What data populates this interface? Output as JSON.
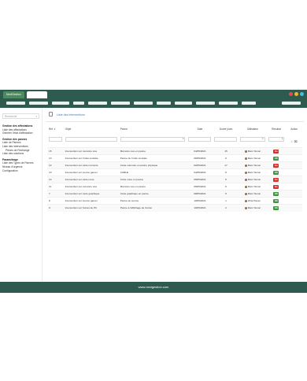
{
  "app": {
    "tab_label": "NextGestion"
  },
  "colors": {
    "bar": "#2f5a4f",
    "ko": "#d9302c",
    "ok": "#3b9b3b",
    "link": "#3a7bc0"
  },
  "window_dots": [
    "#e64c4c",
    "#f0b429",
    "#3bbfe6"
  ],
  "sidebar": {
    "select_placeholder": "Recherche",
    "items": [
      {
        "label": "Gestion des affectations",
        "head": true
      },
      {
        "label": "Liste des affectations",
        "head": false
      },
      {
        "label": "Générer l'état d'affectation",
        "head": false
      },
      {
        "label": "Gestion des pannes",
        "head": true
      },
      {
        "label": "Liste de Pannes",
        "head": false
      },
      {
        "label": "Liste des interventions",
        "head": false
      },
      {
        "label": "Pièces de Rechange",
        "head": false,
        "indent": true
      },
      {
        "label": "Liste des solutions",
        "head": false
      },
      {
        "label": "Paramétrage",
        "head": true
      },
      {
        "label": "Liste des Types de Pannes",
        "head": false
      },
      {
        "label": "Niveau d'urgence",
        "head": false
      },
      {
        "label": "Configuration",
        "head": false
      }
    ]
  },
  "main": {
    "title": "Liste des interventions"
  },
  "table": {
    "headers": [
      "Ref. ▾",
      "Objet",
      "Panne",
      "Date",
      "Durée jours",
      "Utilisateur",
      "Résultat",
      "Action"
    ],
    "rows": [
      [
        "15",
        "Intervention sur mémoire vive",
        "Mémoire vive en panne",
        "04/05/2021",
        "15",
        "Marc Simon",
        "Ko"
      ],
      [
        "13",
        "Intervention sur l'unité centrale",
        "Panne de l'unité centrale",
        "06/05/2021",
        "9",
        "Marc Simon",
        "OK"
      ],
      [
        "14",
        "Intervention sur carte mémoire",
        "Carte mémoire en panne physique",
        "02/05/2021",
        "17",
        "Marc Simon",
        "Ko"
      ],
      [
        "10",
        "Intervention sur source gamer",
        "CABLE",
        "04/05/2021",
        "8",
        "Marc Simon",
        "OK"
      ],
      [
        "12",
        "Intervention sur carte mère",
        "Carte mère en panne",
        "05/05/2021",
        "5",
        "Marc Simon",
        "Ko"
      ],
      [
        "11",
        "Intervention sur mémoire vive",
        "Mémoire vive en panne",
        "05/05/2021",
        "6",
        "Marc Simon",
        "Ko"
      ],
      [
        "7",
        "Intervention sur carte graphique",
        "Carte graphique en panne",
        "08/05/2021",
        "5",
        "Marc Simon",
        "OK"
      ],
      [
        "8",
        "Intervention sur source gamer",
        "Panne de source",
        "10/06/2021",
        "1",
        "Dhia Haven",
        "OK"
      ],
      [
        "9",
        "Intervention sur l'écran de PC",
        "Panne à l'affichage de l'écran",
        "10/05/2021",
        "2",
        "Marc Simon",
        "OK"
      ]
    ]
  },
  "footer": {
    "text": "www.nextgestion.com"
  }
}
